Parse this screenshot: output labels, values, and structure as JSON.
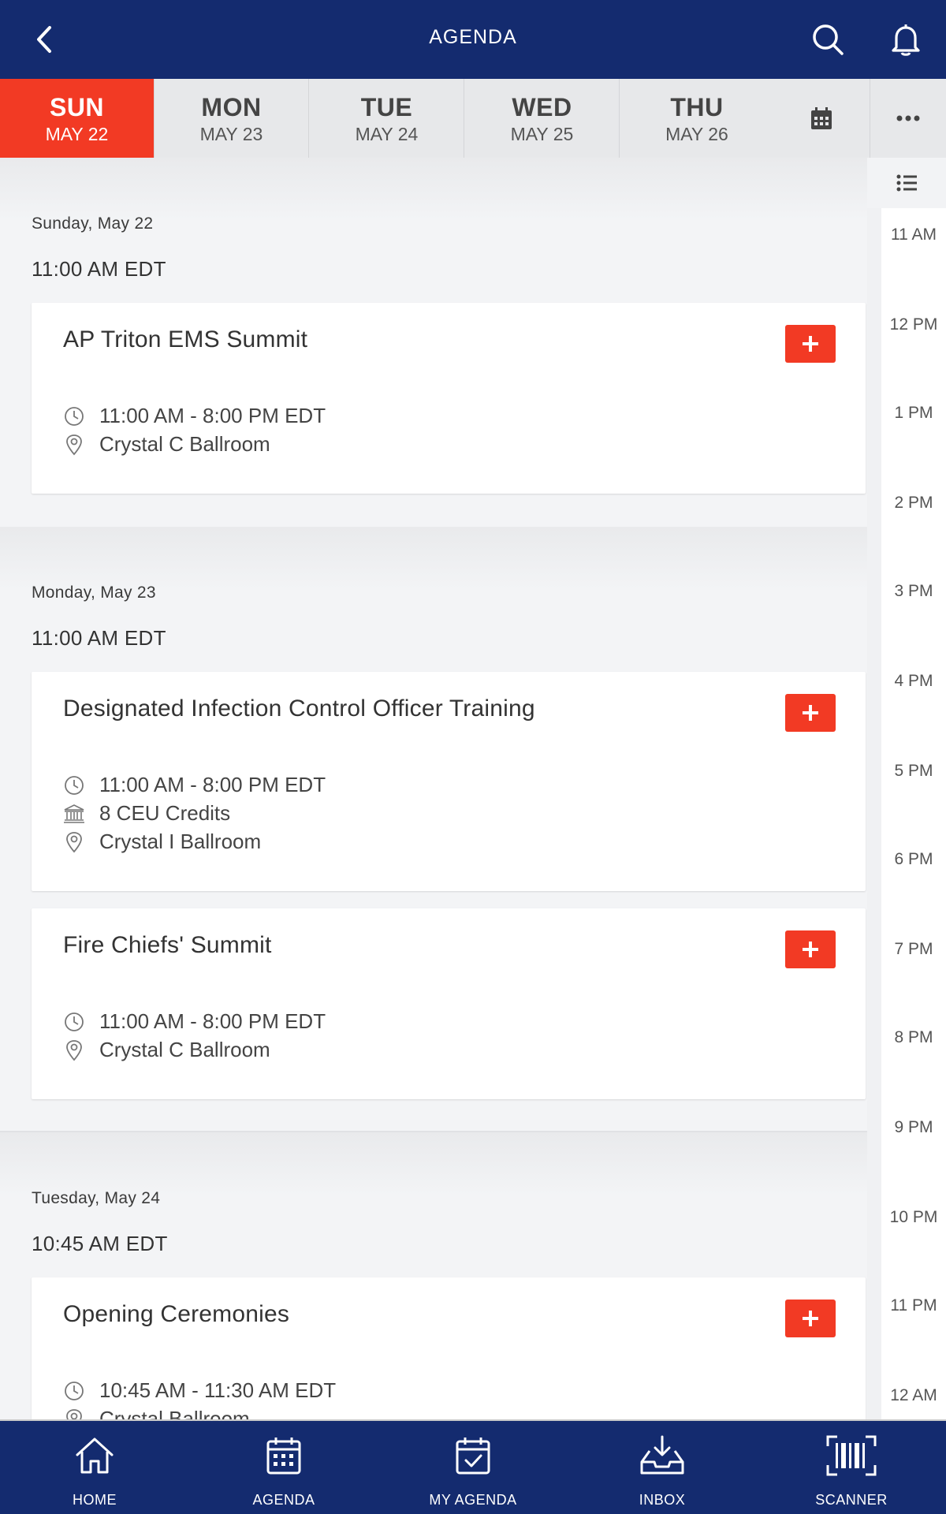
{
  "header": {
    "title": "AGENDA"
  },
  "days": [
    {
      "dow": "SUN",
      "date": "MAY 22",
      "active": true
    },
    {
      "dow": "MON",
      "date": "MAY 23",
      "active": false
    },
    {
      "dow": "TUE",
      "date": "MAY 24",
      "active": false
    },
    {
      "dow": "WED",
      "date": "MAY 25",
      "active": false
    },
    {
      "dow": "THU",
      "date": "MAY 26",
      "active": false
    }
  ],
  "rail": {
    "hours": [
      "11 AM",
      "12 PM",
      "1 PM",
      "2 PM",
      "3 PM",
      "4 PM",
      "5 PM",
      "6 PM",
      "7 PM",
      "8 PM",
      "9 PM",
      "10 PM",
      "11 PM",
      "12 AM"
    ]
  },
  "sections": [
    {
      "day": "Sunday, May 22",
      "time": "11:00 AM EDT",
      "sessions": [
        {
          "title": "AP Triton EMS Summit",
          "time": "11:00 AM - 8:00 PM EDT",
          "location": "Crystal C Ballroom"
        }
      ]
    },
    {
      "day": "Monday, May 23",
      "time": "11:00 AM EDT",
      "sessions": [
        {
          "title": "Designated Infection Control Officer Training",
          "time": "11:00 AM - 8:00 PM EDT",
          "credits": "8 CEU Credits",
          "location": "Crystal I Ballroom"
        },
        {
          "title": "Fire Chiefs' Summit",
          "time": "11:00 AM - 8:00 PM EDT",
          "location": "Crystal C Ballroom"
        }
      ]
    },
    {
      "day": "Tuesday, May 24",
      "time": "10:45 AM EDT",
      "sessions": [
        {
          "title": "Opening Ceremonies",
          "time": "10:45 AM - 11:30 AM EDT",
          "location": "Crystal Ballroom"
        }
      ]
    }
  ],
  "nav": [
    {
      "label": "HOME",
      "icon": "home-icon"
    },
    {
      "label": "AGENDA",
      "icon": "calendar-icon"
    },
    {
      "label": "MY AGENDA",
      "icon": "calendar-check-icon"
    },
    {
      "label": "INBOX",
      "icon": "inbox-icon"
    },
    {
      "label": "SCANNER",
      "icon": "barcode-icon"
    }
  ],
  "colors": {
    "header": "#142b6f",
    "accent": "#f23a24"
  }
}
